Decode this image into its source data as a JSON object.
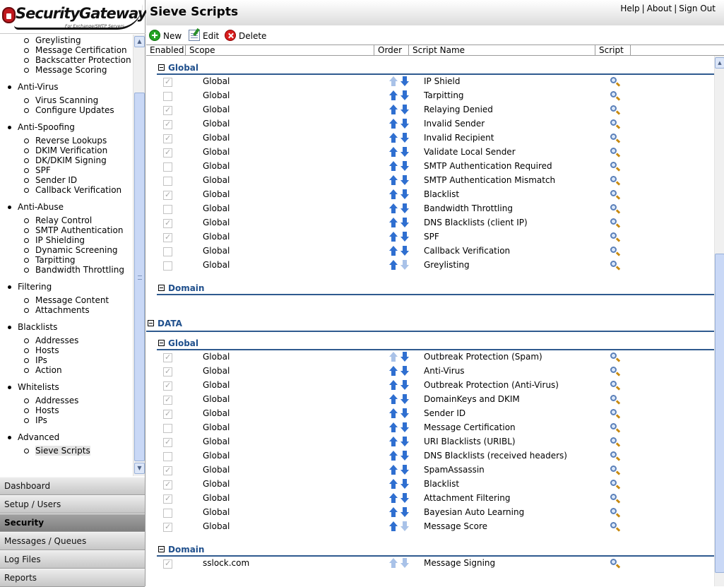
{
  "app": {
    "name": "SecurityGateway",
    "tagline": "For Exchange/SMTP Servers"
  },
  "sidebar": {
    "sections": [
      {
        "label": "",
        "items": [
          "Greylisting",
          "Message Certification",
          "Backscatter Protection",
          "Message Scoring"
        ]
      },
      {
        "label": "Anti-Virus",
        "items": [
          "Virus Scanning",
          "Configure Updates"
        ]
      },
      {
        "label": "Anti-Spoofing",
        "items": [
          "Reverse Lookups",
          "DKIM Verification",
          "DK/DKIM Signing",
          "SPF",
          "Sender ID",
          "Callback Verification"
        ]
      },
      {
        "label": "Anti-Abuse",
        "items": [
          "Relay Control",
          "SMTP Authentication",
          "IP Shielding",
          "Dynamic Screening",
          "Tarpitting",
          "Bandwidth Throttling"
        ]
      },
      {
        "label": "Filtering",
        "items": [
          "Message Content",
          "Attachments"
        ]
      },
      {
        "label": "Blacklists",
        "items": [
          "Addresses",
          "Hosts",
          "IPs",
          "Action"
        ]
      },
      {
        "label": "Whitelists",
        "items": [
          "Addresses",
          "Hosts",
          "IPs"
        ]
      },
      {
        "label": "Advanced",
        "items": [
          "Sieve Scripts"
        ]
      }
    ],
    "selected_item": "Sieve Scripts",
    "nav_buttons": [
      "Dashboard",
      "Setup / Users",
      "Security",
      "Messages / Queues",
      "Log Files",
      "Reports"
    ],
    "active_nav": "Security"
  },
  "header": {
    "title": "Sieve Scripts",
    "links": [
      "Help",
      "About",
      "Sign Out"
    ]
  },
  "toolbar": {
    "new_label": "New",
    "edit_label": "Edit",
    "delete_label": "Delete"
  },
  "table": {
    "columns": [
      "Enabled",
      "Scope",
      "Order",
      "Script Name",
      "Script"
    ],
    "groups": [
      {
        "title": "",
        "subgroups": [
          {
            "title": "Global",
            "rows": [
              {
                "enabled": true,
                "scope": "Global",
                "name": "IP Shield"
              },
              {
                "enabled": false,
                "scope": "Global",
                "name": "Tarpitting"
              },
              {
                "enabled": true,
                "scope": "Global",
                "name": "Relaying Denied"
              },
              {
                "enabled": true,
                "scope": "Global",
                "name": "Invalid Sender"
              },
              {
                "enabled": true,
                "scope": "Global",
                "name": "Invalid Recipient"
              },
              {
                "enabled": true,
                "scope": "Global",
                "name": "Validate Local Sender"
              },
              {
                "enabled": false,
                "scope": "Global",
                "name": "SMTP Authentication Required"
              },
              {
                "enabled": false,
                "scope": "Global",
                "name": "SMTP Authentication Mismatch"
              },
              {
                "enabled": true,
                "scope": "Global",
                "name": "Blacklist"
              },
              {
                "enabled": false,
                "scope": "Global",
                "name": "Bandwidth Throttling"
              },
              {
                "enabled": true,
                "scope": "Global",
                "name": "DNS Blacklists (client IP)"
              },
              {
                "enabled": true,
                "scope": "Global",
                "name": "SPF"
              },
              {
                "enabled": false,
                "scope": "Global",
                "name": "Callback Verification"
              },
              {
                "enabled": false,
                "scope": "Global",
                "name": "Greylisting"
              }
            ]
          },
          {
            "title": "Domain",
            "rows": []
          }
        ]
      },
      {
        "title": "DATA",
        "subgroups": [
          {
            "title": "Global",
            "rows": [
              {
                "enabled": true,
                "scope": "Global",
                "name": "Outbreak Protection (Spam)"
              },
              {
                "enabled": true,
                "scope": "Global",
                "name": "Anti-Virus"
              },
              {
                "enabled": true,
                "scope": "Global",
                "name": "Outbreak Protection (Anti-Virus)"
              },
              {
                "enabled": true,
                "scope": "Global",
                "name": "DomainKeys and DKIM"
              },
              {
                "enabled": true,
                "scope": "Global",
                "name": "Sender ID"
              },
              {
                "enabled": false,
                "scope": "Global",
                "name": "Message Certification"
              },
              {
                "enabled": true,
                "scope": "Global",
                "name": "URI Blacklists (URIBL)"
              },
              {
                "enabled": false,
                "scope": "Global",
                "name": "DNS Blacklists (received headers)"
              },
              {
                "enabled": true,
                "scope": "Global",
                "name": "SpamAssassin"
              },
              {
                "enabled": true,
                "scope": "Global",
                "name": "Blacklist"
              },
              {
                "enabled": true,
                "scope": "Global",
                "name": "Attachment Filtering"
              },
              {
                "enabled": false,
                "scope": "Global",
                "name": "Bayesian Auto Learning"
              },
              {
                "enabled": true,
                "scope": "Global",
                "name": "Message Score"
              }
            ]
          },
          {
            "title": "Domain",
            "rows": [
              {
                "enabled": true,
                "scope": "sslock.com",
                "name": "Message Signing"
              }
            ]
          }
        ]
      }
    ]
  }
}
